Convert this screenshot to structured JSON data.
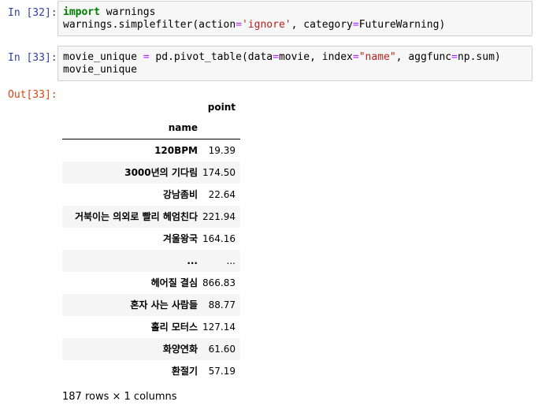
{
  "cells": [
    {
      "prompt": "In [32]:",
      "code": {
        "line1_kw": "import",
        "line1_rest": " warnings",
        "line2_a": "warnings.simplefilter(action",
        "line2_eq1": "=",
        "line2_str": "'ignore'",
        "line2_b": ", category",
        "line2_eq2": "=",
        "line2_c": "FutureWarning)"
      }
    },
    {
      "prompt": "In [33]:",
      "code": {
        "l1_a": "movie_unique ",
        "l1_eq": "=",
        "l1_b": " pd.pivot_table(data",
        "l1_eq2": "=",
        "l1_c": "movie, index",
        "l1_eq3": "=",
        "l1_str": "\"name\"",
        "l1_d": ", aggfunc",
        "l1_eq4": "=",
        "l1_e": "np.sum)",
        "l2": "movie_unique"
      }
    }
  ],
  "output": {
    "prompt": "Out[33]:",
    "column_header": "point",
    "index_name": "name",
    "rows": [
      {
        "index": "120BPM",
        "value": "19.39"
      },
      {
        "index": "3000년의 기다림",
        "value": "174.50"
      },
      {
        "index": "강남좀비",
        "value": "22.64"
      },
      {
        "index": "거북이는 의외로 빨리 헤엄친다",
        "value": "221.94"
      },
      {
        "index": "겨울왕국",
        "value": "164.16"
      },
      {
        "index": "...",
        "value": "..."
      },
      {
        "index": "헤어질 결심",
        "value": "866.83"
      },
      {
        "index": "혼자 사는 사람들",
        "value": "88.77"
      },
      {
        "index": "홀리 모터스",
        "value": "127.14"
      },
      {
        "index": "화양연화",
        "value": "61.60"
      },
      {
        "index": "환절기",
        "value": "57.19"
      }
    ],
    "footer": "187 rows × 1 columns"
  }
}
